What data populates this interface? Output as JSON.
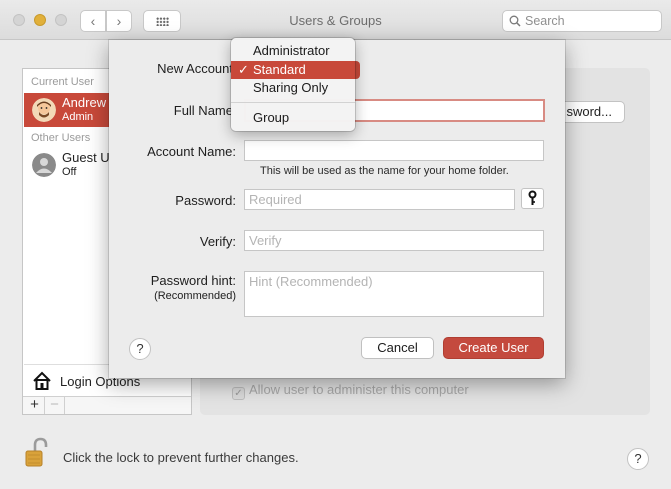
{
  "window": {
    "title": "Users & Groups"
  },
  "toolbar": {
    "back_label": "‹",
    "forward_label": "›"
  },
  "search": {
    "placeholder": "Search"
  },
  "sidebar": {
    "current_user_label": "Current User",
    "other_users_label": "Other Users",
    "users": [
      {
        "name": "Andrew",
        "role": "Admin",
        "selected": true
      },
      {
        "name": "Guest U",
        "role": "Off",
        "selected": false
      }
    ],
    "login_options_label": "Login Options",
    "add_label": "+",
    "remove_label": "−"
  },
  "pane": {
    "change_password_label": "sword...",
    "allow_admin_label": "Allow user to administer this computer"
  },
  "footer": {
    "lock_text": "Click the lock to prevent further changes.",
    "help_label": "?"
  },
  "sheet": {
    "new_account_label": "New Account",
    "full_name_label": "Full Name",
    "full_name_value": "",
    "account_name_label": "Account Name:",
    "account_name_value": "",
    "account_name_hint": "This will be used as the name for your home folder.",
    "password_label": "Password:",
    "password_placeholder": "Required",
    "verify_label": "Verify:",
    "verify_placeholder": "Verify",
    "hint_label_line1": "Password hint:",
    "hint_label_line2": "(Recommended)",
    "hint_placeholder": "Hint (Recommended)",
    "help_label": "?",
    "cancel_label": "Cancel",
    "create_label": "Create User"
  },
  "account_type_menu": {
    "options": [
      "Administrator",
      "Standard",
      "Sharing Only",
      "Group"
    ],
    "selected": "Standard",
    "check_glyph": "✓"
  },
  "colors": {
    "accent": "#c8493a",
    "create_button": "#c44a3e"
  }
}
